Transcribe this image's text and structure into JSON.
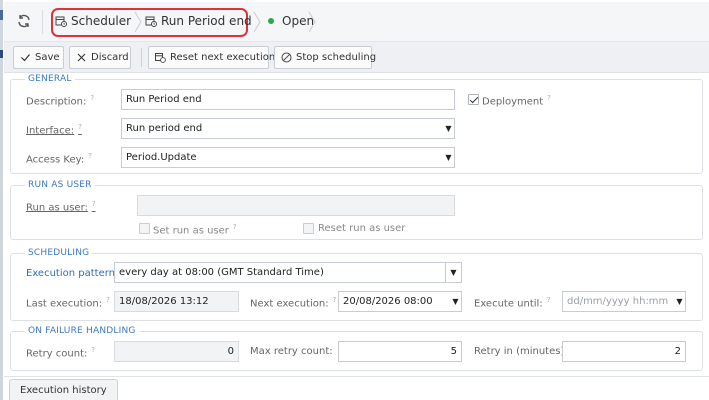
{
  "breadcrumb": {
    "items": [
      {
        "label": "Scheduler",
        "icon": "calendar-icon"
      },
      {
        "label": "Run Period end",
        "icon": "calendar-icon"
      }
    ],
    "status": "Open",
    "status_color": "#2aa84a",
    "highlight_color": "#e0303a"
  },
  "toolbar": {
    "save": "Save",
    "discard": "Discard",
    "reset_next": "Reset next execution",
    "stop": "Stop scheduling"
  },
  "general": {
    "title": "GENERAL",
    "description_label": "Description:",
    "description_value": "Run Period end",
    "deployment_label": "Deployment",
    "deployment_checked": true,
    "interface_label": "Interface:",
    "interface_value": "Run period end",
    "access_key_label": "Access Key:",
    "access_key_value": "Period.Update"
  },
  "run_as_user": {
    "title": "RUN AS USER",
    "run_as_label": "Run as user:",
    "run_as_value": "",
    "set_label": "Set run as user",
    "reset_label": "Reset run as user"
  },
  "scheduling": {
    "title": "SCHEDULING",
    "pattern_label": "Execution pattern:",
    "pattern_value": "every day at 08:00 (GMT Standard Time)",
    "last_label": "Last execution:",
    "last_value": "18/08/2026 13:12",
    "next_label": "Next execution:",
    "next_value": "20/08/2026 08:00",
    "until_label": "Execute until:",
    "until_placeholder": "dd/mm/yyyy hh:mm"
  },
  "failure": {
    "title": "ON FAILURE HANDLING",
    "retry_count_label": "Retry count:",
    "retry_count_value": "0",
    "max_retry_label": "Max retry count:",
    "max_retry_value": "5",
    "retry_in_label": "Retry in (minutes):",
    "retry_in_value": "2"
  },
  "tabs": {
    "execution_history": "Execution history"
  },
  "help_mark": "?",
  "dropdown_arrow": "▼"
}
